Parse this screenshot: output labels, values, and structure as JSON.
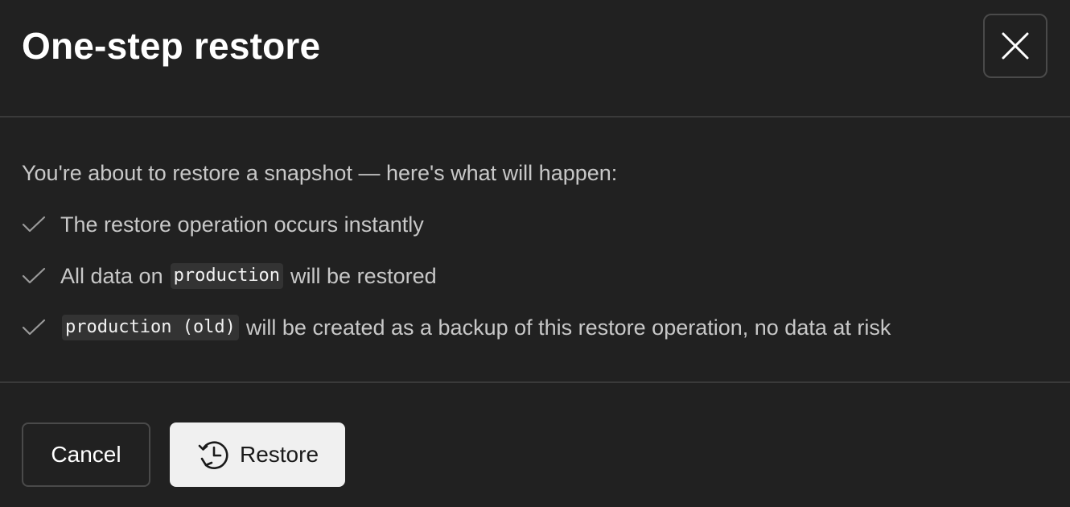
{
  "dialog": {
    "title": "One-step restore",
    "close_icon": "close-icon"
  },
  "body": {
    "intro": "You're about to restore a snapshot — here's what will happen:",
    "items": [
      {
        "icon": "check-icon",
        "text": "The restore operation occurs instantly"
      },
      {
        "icon": "check-icon",
        "prefix": "All data on",
        "code": "production",
        "suffix": "will be restored"
      },
      {
        "icon": "check-icon",
        "code": "production (old)",
        "suffix": "will be created as a backup of this restore operation, no data at risk"
      }
    ]
  },
  "footer": {
    "cancel_label": "Cancel",
    "restore_label": "Restore",
    "restore_icon": "history-restore-icon"
  },
  "colors": {
    "background": "#212121",
    "divider": "#3a3a3a",
    "text_muted": "#c8c8c8",
    "code_bg": "#333333",
    "primary_button_bg": "#f0f0f0"
  }
}
